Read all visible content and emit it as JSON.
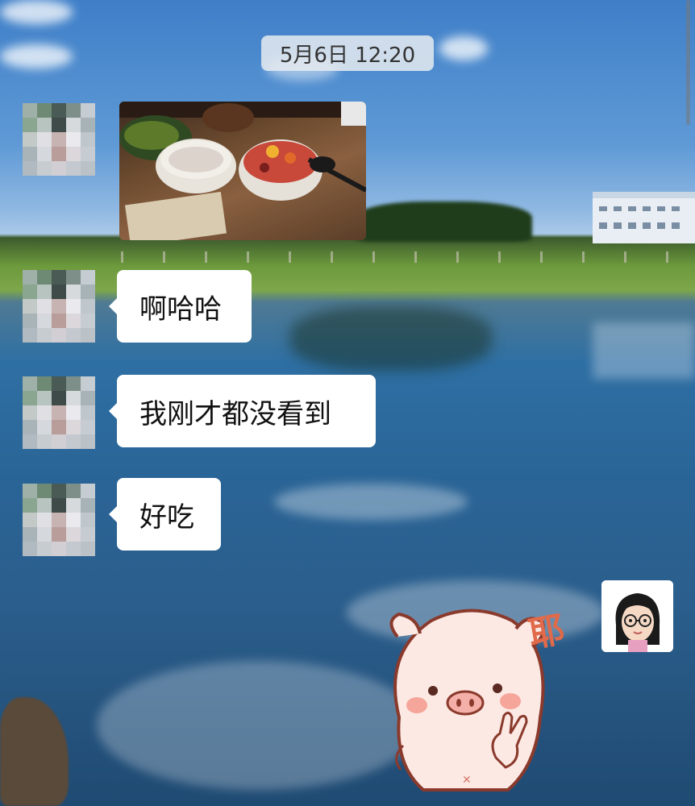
{
  "chat": {
    "timestamp": "5月6日 12:20",
    "messages": [
      {
        "type": "image",
        "sender": "contact",
        "description_icon": "food-photo"
      },
      {
        "type": "text",
        "sender": "contact",
        "text": "啊哈哈"
      },
      {
        "type": "text",
        "sender": "contact",
        "text": "我刚才都没看到"
      },
      {
        "type": "text",
        "sender": "contact",
        "text": "好吃"
      },
      {
        "type": "sticker",
        "sender": "self",
        "sticker_text": "耶"
      }
    ]
  },
  "colors": {
    "bubble": "#ffffff",
    "timestamp_bg": "#e6ebf0",
    "sticker_text": "#e06a4a"
  }
}
